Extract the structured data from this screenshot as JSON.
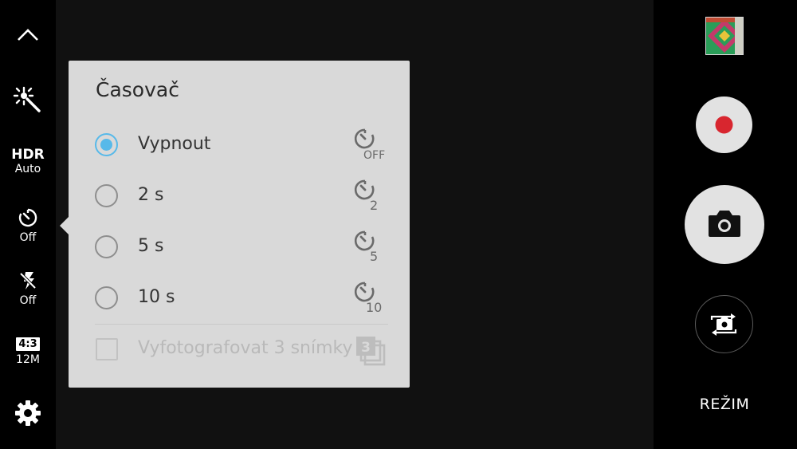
{
  "left_bar": {
    "collapse_icon": "chevron-up-icon",
    "effects_icon": "magic-wand-icon",
    "hdr": {
      "title": "HDR",
      "value": "Auto"
    },
    "timer": {
      "icon": "timer-icon",
      "value": "Off"
    },
    "flash": {
      "icon": "flash-off-icon",
      "value": "Off"
    },
    "ratio": {
      "label": "4:3",
      "value": "12M"
    },
    "settings_icon": "gear-icon"
  },
  "timer_popup": {
    "title": "Časovač",
    "options": [
      {
        "label": "Vypnout",
        "selected": true,
        "icon": "timer-off-icon",
        "icon_text": "OFF"
      },
      {
        "label": "2 s",
        "selected": false,
        "icon": "timer-2s-icon",
        "icon_text": "2"
      },
      {
        "label": "5 s",
        "selected": false,
        "icon": "timer-5s-icon",
        "icon_text": "5"
      },
      {
        "label": "10 s",
        "selected": false,
        "icon": "timer-10s-icon",
        "icon_text": "10"
      }
    ],
    "burst": {
      "label": "Vyfotografovat 3 snímky",
      "checked": false,
      "enabled": false,
      "icon": "burst-3-icon",
      "icon_text": "3"
    }
  },
  "right_bar": {
    "gallery_icon": "gallery-thumbnail-icon",
    "record_icon": "record-icon",
    "shutter_icon": "camera-icon",
    "switch_icon": "switch-camera-icon",
    "mode_label": "REŽIM"
  },
  "colors": {
    "accent": "#57b9e9",
    "record": "#d8262f",
    "popup_bg": "#d9d9d9",
    "button_bg": "#e2e2e2"
  }
}
